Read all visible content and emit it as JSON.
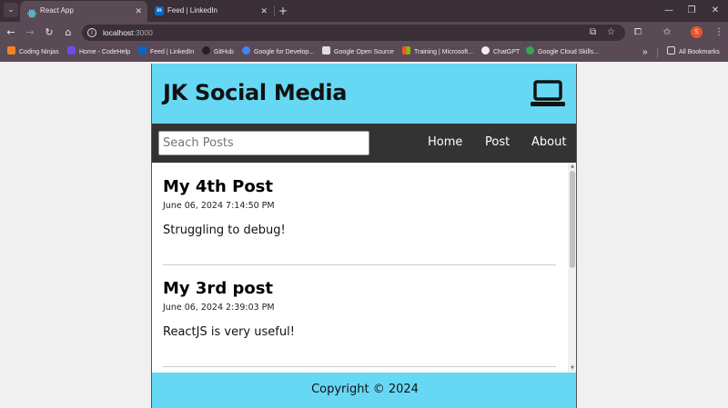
{
  "browser": {
    "tabs": [
      {
        "title": "React App",
        "active": true,
        "icon": "react-icon",
        "icon_color": "#61dafb"
      },
      {
        "title": "Feed | LinkedIn",
        "active": false,
        "icon": "linkedin-icon",
        "icon_color": "#0a66c2"
      }
    ],
    "url_host": "localhost",
    "url_port": ":3000",
    "profile_initial": "S",
    "bookmarks": [
      {
        "label": "Coding Ninjas",
        "color": "#f58220"
      },
      {
        "label": "Home - CodeHelp",
        "color": "#6b4ee6"
      },
      {
        "label": "Feed | LinkedIn",
        "color": "#0a66c2"
      },
      {
        "label": "GitHub",
        "color": "#222222"
      },
      {
        "label": "Google for Develop...",
        "color": "#4285f4"
      },
      {
        "label": "Google Open Source",
        "color": "#ffffff"
      },
      {
        "label": "Training | Microsoft...",
        "color": "#f35325"
      },
      {
        "label": "ChatGPT",
        "color": "#ffffff"
      },
      {
        "label": "Google Cloud Skills...",
        "color": "#34a853"
      }
    ],
    "all_bookmarks": "All Bookmarks",
    "overflow": "»"
  },
  "app": {
    "title": "JK Social Media",
    "search_placeholder": "Seach Posts",
    "nav": [
      "Home",
      "Post",
      "About"
    ],
    "posts": [
      {
        "title": "My 4th Post",
        "date": "June 06, 2024 7:14:50 PM",
        "body": "Struggling to debug!"
      },
      {
        "title": "My 3rd post",
        "date": "June 06, 2024 2:39:03 PM",
        "body": "ReactJS is very useful!"
      }
    ],
    "footer": "Copyright © 2024"
  },
  "colors": {
    "accent": "#66d8f4",
    "nav_bg": "#333333"
  }
}
